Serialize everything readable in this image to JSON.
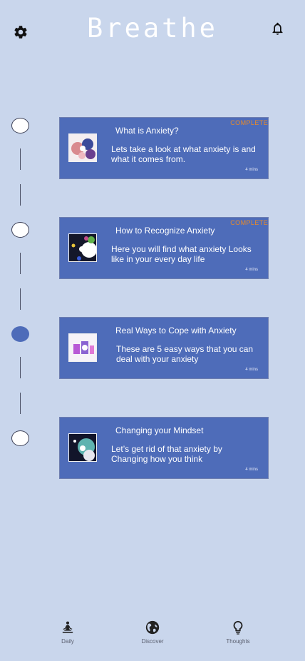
{
  "app": {
    "title": "Breathe"
  },
  "header": {
    "settings_icon": "gear-icon",
    "notifications_icon": "bell-icon"
  },
  "lessons": [
    {
      "title": "What is Anxiety?",
      "description": "Lets take a look at what anxiety is and what it comes from.",
      "duration": "4 mins",
      "status": "COMPLETE",
      "completed": true
    },
    {
      "title": "How to Recognize Anxiety",
      "description": "Here you will find what anxiety Looks like in your every day life",
      "duration": "4 mins",
      "status": "COMPLETE",
      "completed": true
    },
    {
      "title": "Real Ways to Cope with Anxiety",
      "description": "These are 5 easy ways that you can deal with your anxiety",
      "duration": "4 mins",
      "status": "",
      "completed": false,
      "current": true
    },
    {
      "title": "Changing your Mindset",
      "description": "Let’s get rid of that anxiety by Changing how you think",
      "duration": "4 mins",
      "status": "",
      "completed": false
    }
  ],
  "bottom_nav": {
    "items": [
      {
        "label": "Daily",
        "icon": "meditation-icon"
      },
      {
        "label": "Discover",
        "icon": "globe-icon"
      },
      {
        "label": "Thoughts",
        "icon": "lightbulb-icon"
      }
    ]
  },
  "colors": {
    "background": "#c9d6ec",
    "card": "#4e6cb9",
    "badge": "#e58a2c",
    "active_node": "#4e6cb9"
  }
}
